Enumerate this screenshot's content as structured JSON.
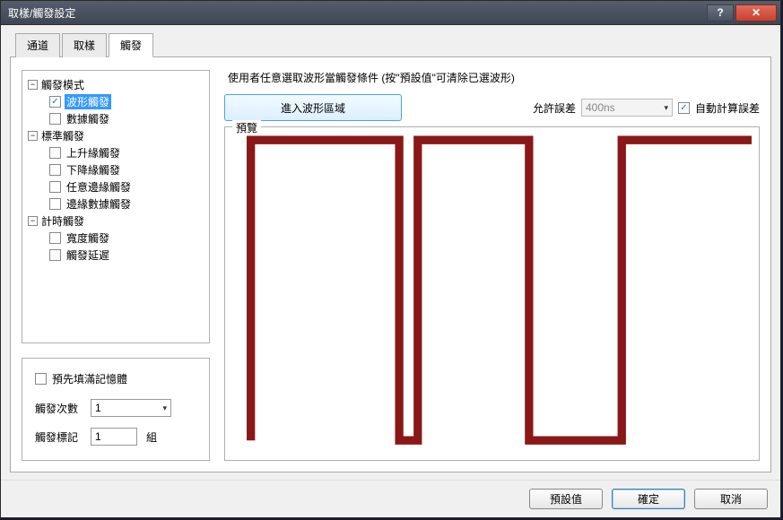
{
  "window": {
    "title": "取樣/觸發設定"
  },
  "tabs": {
    "channel": "通道",
    "sample": "取樣",
    "trigger": "觸發"
  },
  "tree": {
    "group1": {
      "label": "觸發模式",
      "items": [
        {
          "label": "波形觸發",
          "checked": true,
          "selected": true
        },
        {
          "label": "數據觸發",
          "checked": false
        }
      ]
    },
    "group2": {
      "label": "標準觸發",
      "items": [
        {
          "label": "上升緣觸發",
          "checked": false
        },
        {
          "label": "下降緣觸發",
          "checked": false
        },
        {
          "label": "任意邊緣觸發",
          "checked": false
        },
        {
          "label": "邊緣數據觸發",
          "checked": false
        }
      ]
    },
    "group3": {
      "label": "計時觸發",
      "items": [
        {
          "label": "寬度觸發",
          "checked": false
        },
        {
          "label": "觸發延遲",
          "checked": false
        }
      ]
    }
  },
  "controls": {
    "prefill": {
      "label": "預先填滿記憶體",
      "checked": false
    },
    "count": {
      "label": "觸發次數",
      "value": "1"
    },
    "mark": {
      "label": "觸發標記",
      "value": "1",
      "suffix": "組"
    }
  },
  "right": {
    "instruction": "使用者任意選取波形當觸發條件 (按\"預設值\"可清除已選波形)",
    "enter_button": "進入波形區域",
    "tolerance_label": "允許誤差",
    "tolerance_value": "400ns",
    "auto_calc": {
      "label": "自動計算誤差",
      "checked": true
    },
    "preview_label": "預覽"
  },
  "footer": {
    "default": "預設值",
    "ok": "確定",
    "cancel": "取消"
  },
  "icons": {
    "minus": "−",
    "check": "✓",
    "caret": "▾",
    "help": "?",
    "close": "✕"
  }
}
